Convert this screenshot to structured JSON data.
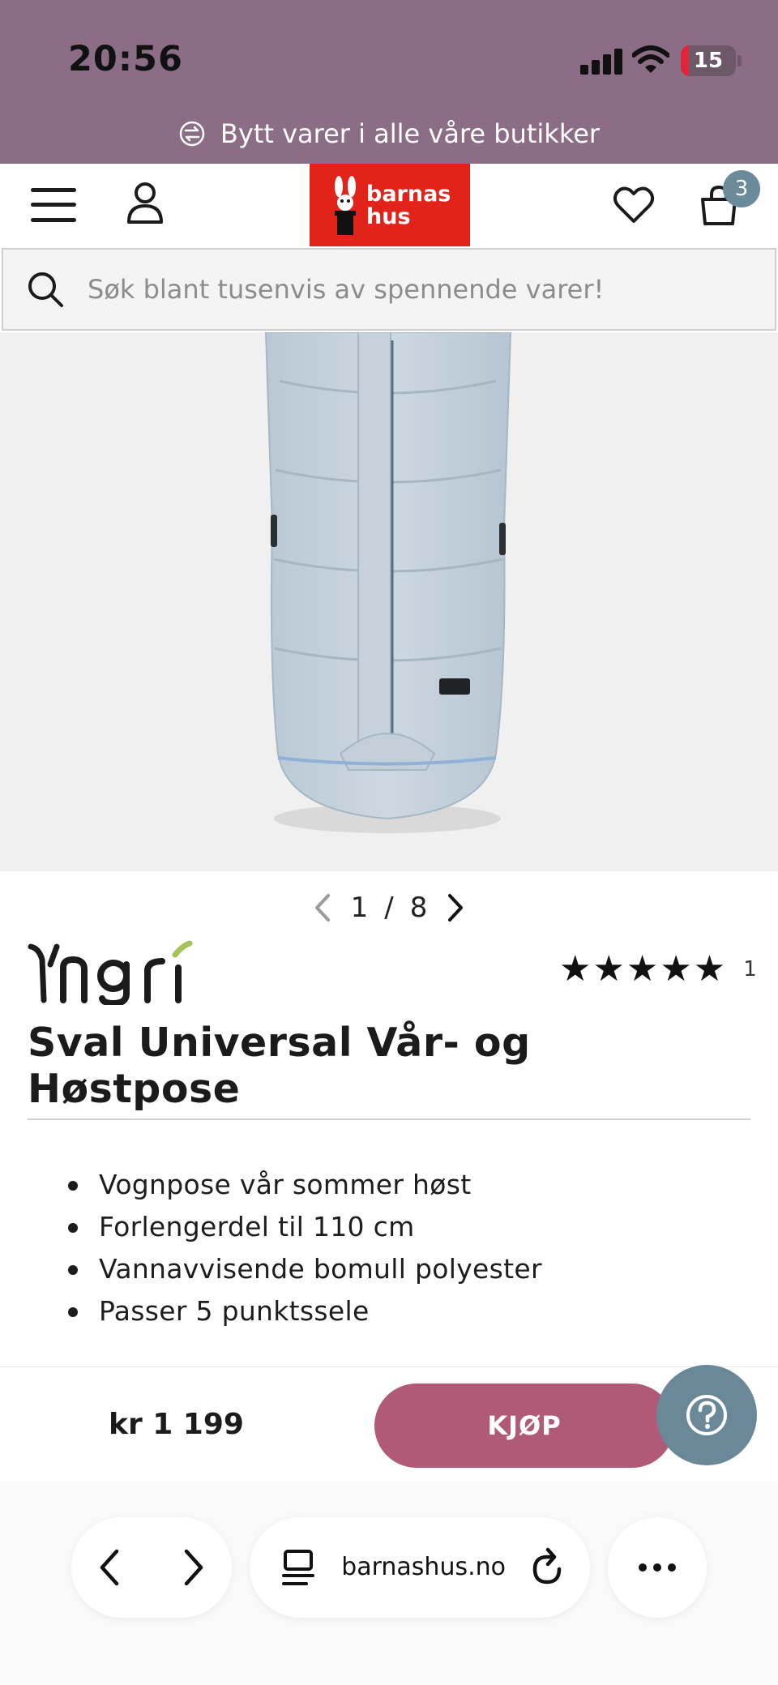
{
  "status_bar": {
    "time": "20:56",
    "battery_level": 15,
    "battery_label": "15"
  },
  "promo": {
    "text": "Bytt varer i alle våre butikker",
    "icon": "exchange-icon"
  },
  "header": {
    "logo_line1": "barnas",
    "logo_line2": "hus",
    "cart_count": "3",
    "brand_color": "#e2231a",
    "accent_color": "#8b6e86"
  },
  "search": {
    "placeholder": "Søk blant tusenvis av spennende varer!"
  },
  "gallery": {
    "current": "1",
    "separator": "/",
    "total": "8"
  },
  "product": {
    "brand": "Yngri",
    "stars": "★★★★★",
    "rating_value": 5,
    "review_count": "1",
    "title": "Sval Universal Vår- og Høstpose",
    "features": [
      "Vognpose vår sommer høst",
      "Forlengerdel til 110 cm",
      "Vannavvisende bomull polyester",
      "Passer 5 punktssele"
    ]
  },
  "buybar": {
    "price": "kr 1 199",
    "buy_label": "KJØP",
    "buy_color": "#b05a78",
    "help_color": "#6a8898"
  },
  "browser": {
    "url": "barnashus.no"
  }
}
